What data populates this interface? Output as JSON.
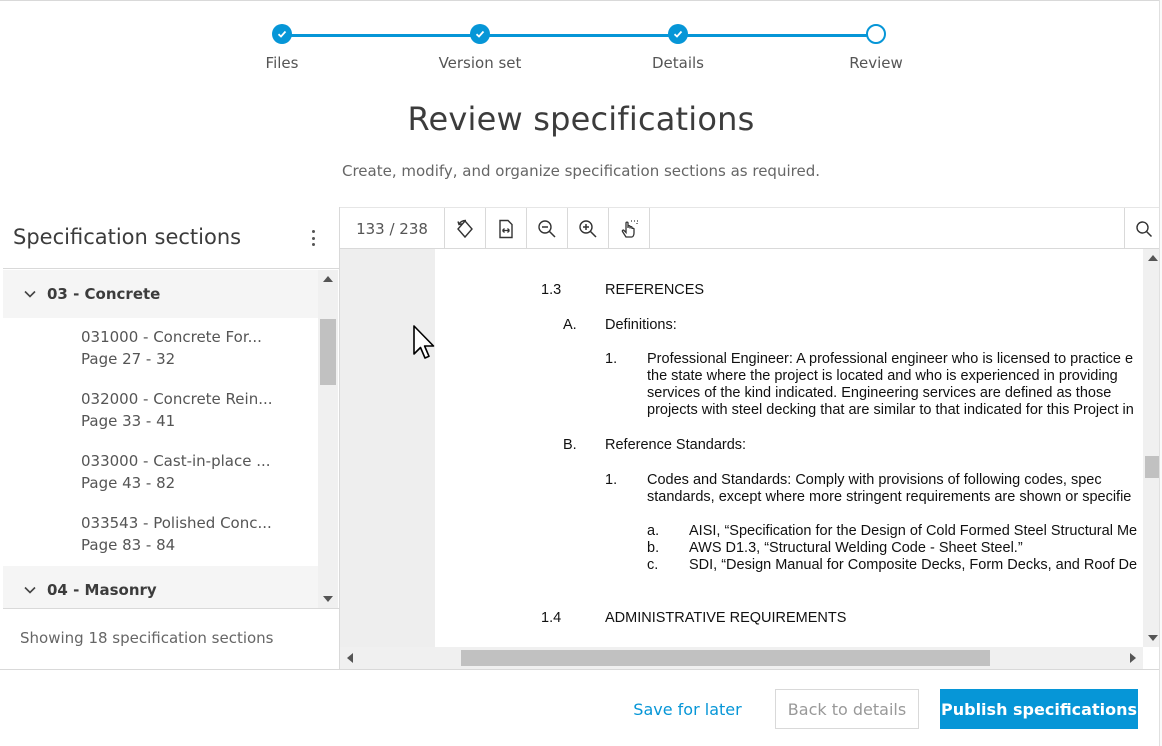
{
  "stepper": {
    "steps": [
      {
        "label": "Files",
        "state": "done"
      },
      {
        "label": "Version set",
        "state": "done"
      },
      {
        "label": "Details",
        "state": "done"
      },
      {
        "label": "Review",
        "state": "current"
      }
    ]
  },
  "header": {
    "title": "Review specifications",
    "subtitle": "Create, modify, and organize specification sections as required."
  },
  "left_panel": {
    "title": "Specification sections",
    "groups": [
      {
        "label": "03 - Concrete",
        "items": [
          {
            "name": "031000 - Concrete For...",
            "pages": "Page 27 - 32"
          },
          {
            "name": "032000 - Concrete Rein...",
            "pages": "Page 33 - 41"
          },
          {
            "name": "033000 - Cast-in-place ...",
            "pages": "Page 43 - 82"
          },
          {
            "name": "033543 - Polished Conc...",
            "pages": "Page 83 - 84"
          }
        ]
      },
      {
        "label": "04 - Masonry",
        "items": []
      }
    ],
    "footer": "Showing 18 specification sections"
  },
  "viewer": {
    "page_indicator": "133 / 238",
    "tools": [
      "rotate-icon",
      "fit-width-icon",
      "zoom-out-icon",
      "zoom-in-icon",
      "pan-hand-icon",
      "search-icon"
    ],
    "document": {
      "s13_num": "1.3",
      "s13_title": "REFERENCES",
      "a_label": "A.",
      "a_title": "Definitions:",
      "a1_num": "1.",
      "a1_l1": "Professional Engineer:  A professional engineer who is licensed to practice e",
      "a1_l2": "the state where the project is located and who is experienced in providing",
      "a1_l3": "services of the kind indicated.  Engineering services are defined as those",
      "a1_l4": "projects with steel decking that are similar to that indicated for this Project in",
      "b_label": "B.",
      "b_title": "Reference Standards:",
      "b1_num": "1.",
      "b1_l1": "Codes and Standards:  Comply with provisions of following codes, spec",
      "b1_l2": "standards, except where more stringent requirements are shown or specifie",
      "ba_label": "a.",
      "ba_text": "AISI, “Specification for the Design of Cold Formed Steel Structural Me",
      "bb_label": "b.",
      "bb_text": "AWS D1.3, “Structural Welding Code - Sheet Steel.”",
      "bc_label": "c.",
      "bc_text": "SDI, “Design Manual for Composite Decks, Form Decks, and Roof De",
      "s14_num": "1.4",
      "s14_title": "ADMINISTRATIVE REQUIREMENTS"
    }
  },
  "footer": {
    "save_label": "Save for later",
    "back_label": "Back to details",
    "publish_label": "Publish specifications"
  },
  "colors": {
    "accent": "#0696d7",
    "border": "#d9d9d9",
    "group_bg": "#f5f5f5"
  }
}
